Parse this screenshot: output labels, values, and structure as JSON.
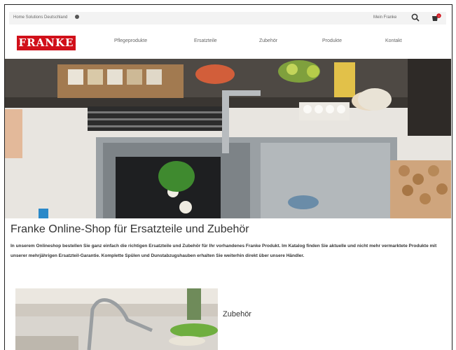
{
  "topbar": {
    "region": "Home Solutions Deutschland",
    "my_franke": "Mein Franke",
    "cart_count": "0"
  },
  "brand": {
    "logo_text": "FRANKE",
    "accent": "#d1101a"
  },
  "nav": {
    "items": [
      "Pflegeprodukte",
      "Ersatzteile",
      "Zubehör",
      "Produkte",
      "Kontakt"
    ]
  },
  "main": {
    "title": "Franke Online-Shop für Ersatzteile und Zubehör",
    "intro": "In unserem Onlineshop bestellen Sie ganz einfach die richtigen Ersatzteile und Zubehör für Ihr vorhandenes Franke Produkt. Im Katalog finden Sie aktuelle und nicht mehr vermarktete Produkte mit unserer mehrjährigen Ersatzteil-Garantie. Komplette Spülen und Dunstabzugshauben erhalten Sie weiterhin direkt über unsere Händler."
  },
  "promo": {
    "label": "Zubehör"
  }
}
